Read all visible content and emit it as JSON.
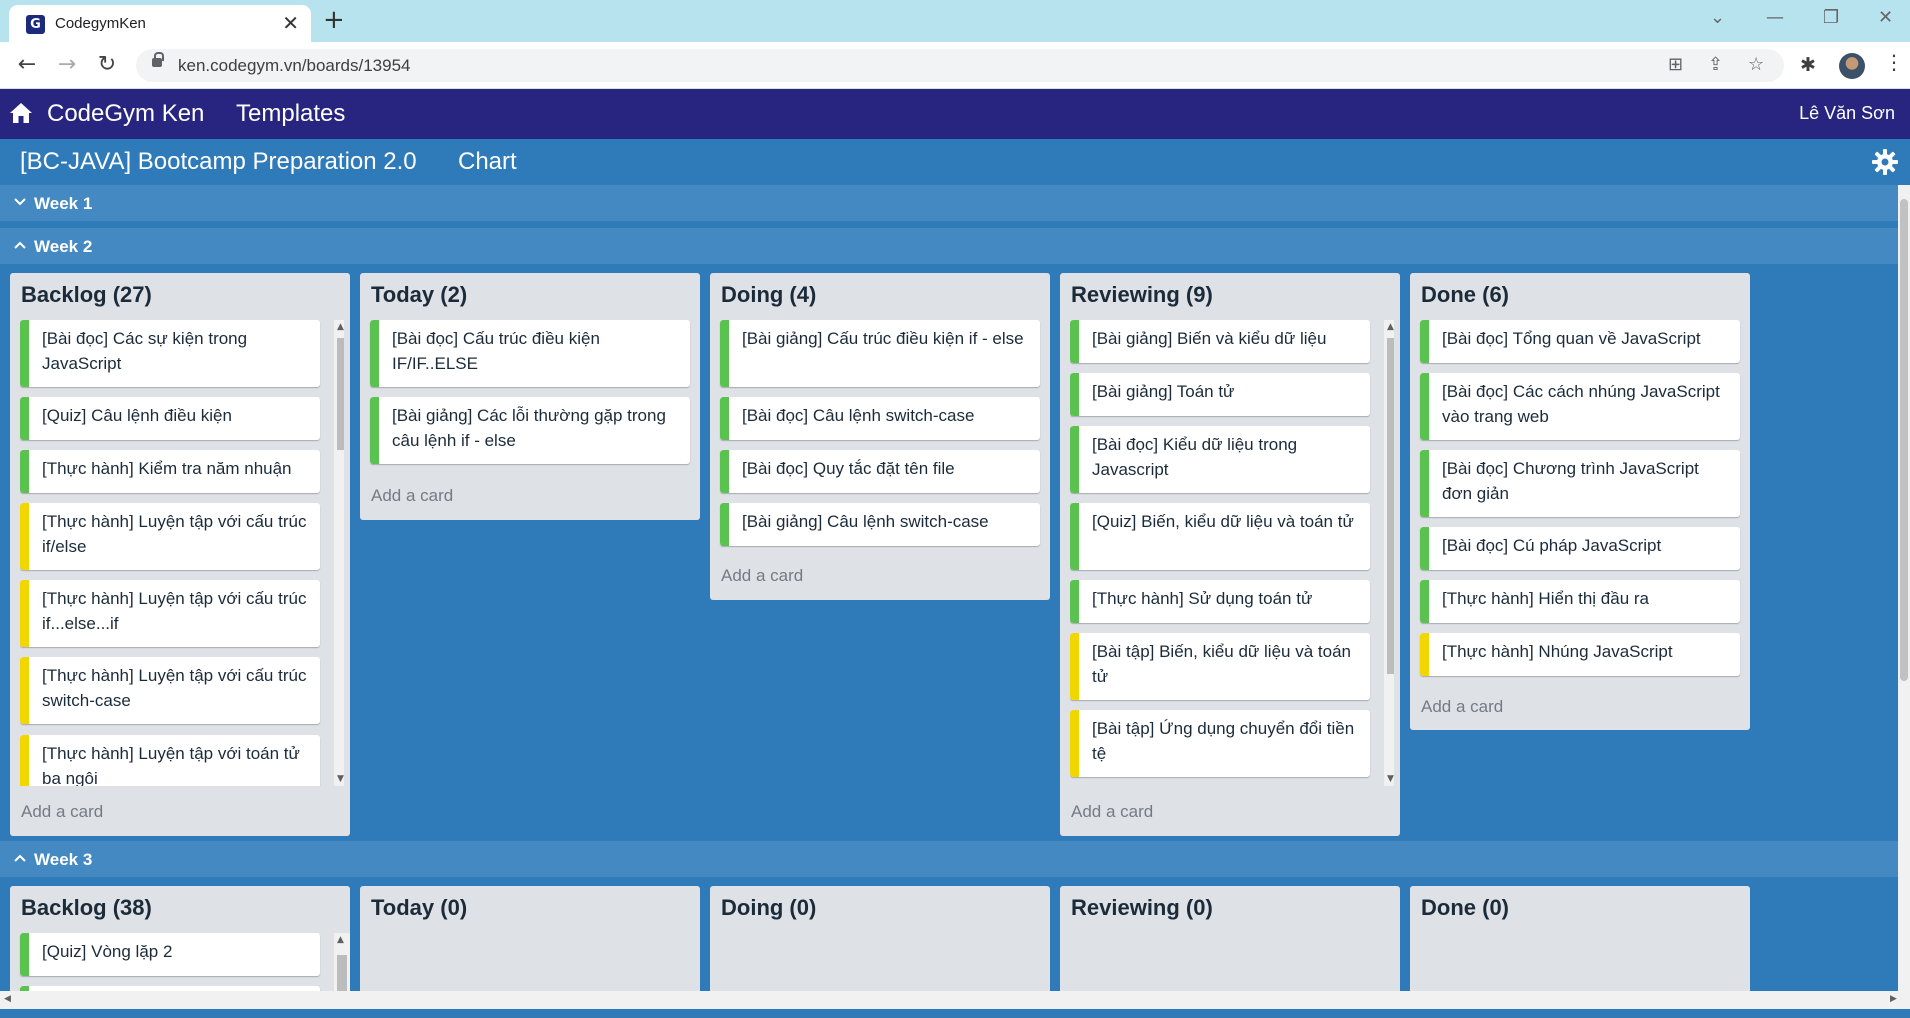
{
  "browser": {
    "tab_title": "CodegymKen",
    "favicon_letter": "G",
    "close_glyph": "✕",
    "new_tab_glyph": "+",
    "url": "ken.codegym.vn/boards/13954"
  },
  "header": {
    "brand": "CodeGym Ken",
    "templates": "Templates",
    "user": "Lê Văn Sơn"
  },
  "board": {
    "title": "[BC-JAVA] Bootcamp Preparation 2.0",
    "chart_link": "Chart"
  },
  "colors": {
    "label_green": "#5ac24e",
    "label_yellow": "#f2d600",
    "header_navy": "#27257f",
    "board_blue": "#2f7ab9"
  },
  "weeks": [
    {
      "label": "Week 1",
      "expanded": false
    },
    {
      "label": "Week 2",
      "expanded": true,
      "columns": [
        {
          "title": "Backlog (27)",
          "add": "Add a card",
          "cards": [
            {
              "text": "[Bài đọc] Các sự kiện trong JavaScript",
              "label": "green"
            },
            {
              "text": "[Quiz] Câu lệnh điều kiện",
              "label": "green"
            },
            {
              "text": "[Thực hành] Kiểm tra năm nhuận",
              "label": "green"
            },
            {
              "text": "[Thực hành] Luyện tập với cấu trúc if/else",
              "label": "yellow"
            },
            {
              "text": "[Thực hành] Luyện tập với cấu trúc if...else...if",
              "label": "yellow"
            },
            {
              "text": "[Thực hành] Luyện tập với cấu trúc switch-case",
              "label": "yellow"
            },
            {
              "text": "[Thực hành] Luyện tập với toán tử ba ngôi",
              "label": "yellow"
            }
          ]
        },
        {
          "title": "Today (2)",
          "add": "Add a card",
          "cards": [
            {
              "text": "[Bài đọc] Cấu trúc điều kiện IF/IF..ELSE",
              "label": "green"
            },
            {
              "text": "[Bài giảng] Các lỗi thường gặp trong câu lệnh if - else",
              "label": "green"
            }
          ]
        },
        {
          "title": "Doing (4)",
          "add": "Add a card",
          "cards": [
            {
              "text": "[Bài giảng] Cấu trúc điều kiện if - else",
              "label": "green"
            },
            {
              "text": "[Bài đọc] Câu lệnh switch-case",
              "label": "green"
            },
            {
              "text": "[Bài đọc] Quy tắc đặt tên file",
              "label": "green"
            },
            {
              "text": "[Bài giảng] Câu lệnh switch-case",
              "label": "green"
            }
          ]
        },
        {
          "title": "Reviewing (9)",
          "add": "Add a card",
          "cards": [
            {
              "text": "[Bài giảng] Biến và kiểu dữ liệu",
              "label": "green"
            },
            {
              "text": "[Bài giảng] Toán tử",
              "label": "green"
            },
            {
              "text": "[Bài đọc] Kiểu dữ liệu trong Javascript",
              "label": "green"
            },
            {
              "text": "[Quiz] Biến, kiểu dữ liệu và toán tử",
              "label": "green"
            },
            {
              "text": "[Thực hành] Sử dụng toán tử",
              "label": "green"
            },
            {
              "text": "[Bài tập] Biến, kiểu dữ liệu và toán tử",
              "label": "yellow"
            },
            {
              "text": "[Bài tập] Ứng dụng chuyển đổi tiền tệ",
              "label": "yellow"
            }
          ]
        },
        {
          "title": "Done (6)",
          "add": "Add a card",
          "cards": [
            {
              "text": "[Bài đọc] Tổng quan về JavaScript",
              "label": "green"
            },
            {
              "text": "[Bài đọc] Các cách nhúng JavaScript vào trang web",
              "label": "green"
            },
            {
              "text": "[Bài đọc] Chương trình JavaScript đơn giản",
              "label": "green"
            },
            {
              "text": "[Bài đọc] Cú pháp JavaScript",
              "label": "green"
            },
            {
              "text": "[Thực hành] Hiển thị đầu ra",
              "label": "green"
            },
            {
              "text": "[Thực hành] Nhúng JavaScript",
              "label": "yellow"
            }
          ]
        }
      ]
    },
    {
      "label": "Week 3",
      "expanded": true,
      "columns": [
        {
          "title": "Backlog (38)",
          "cards": [
            {
              "text": "[Quiz] Vòng lặp 2",
              "label": "green"
            }
          ]
        },
        {
          "title": "Today (0)",
          "cards": []
        },
        {
          "title": "Doing (0)",
          "cards": []
        },
        {
          "title": "Reviewing (0)",
          "cards": []
        },
        {
          "title": "Done (0)",
          "cards": []
        }
      ]
    }
  ]
}
